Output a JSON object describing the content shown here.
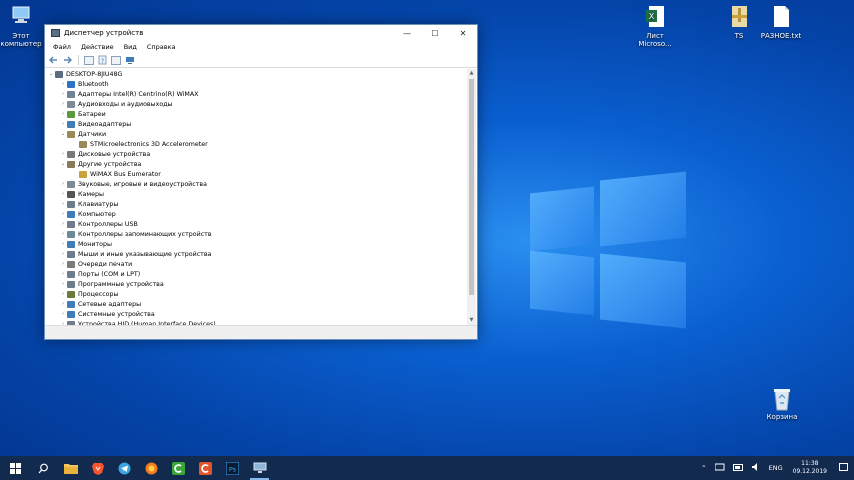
{
  "desktop": {
    "icons": {
      "this_pc": "Этот\nкомпьютер",
      "excel": "Лист\nMicroso...",
      "ts": "TS",
      "txt": "РАЗНОЕ.txt",
      "recycle": "Корзина"
    }
  },
  "window": {
    "title": "Диспетчер устройств",
    "controls": {
      "minimize": "—",
      "maximize": "☐",
      "close": "✕"
    },
    "menu": [
      "Файл",
      "Действие",
      "Вид",
      "Справка"
    ]
  },
  "tree": {
    "root": "DESKTOP-8JIU48G",
    "items": [
      {
        "label": "Bluetooth",
        "expander": "›",
        "child": false,
        "icon_color": "#2f73c9"
      },
      {
        "label": "Адаптеры Intel(R) Centrino(R) WiMAX",
        "expander": "›",
        "child": false,
        "icon_color": "#6f8297"
      },
      {
        "label": "Аудиовходы и аудиовыходы",
        "expander": "›",
        "child": false,
        "icon_color": "#7e8a96"
      },
      {
        "label": "Батареи",
        "expander": "›",
        "child": false,
        "icon_color": "#5b9a3c"
      },
      {
        "label": "Видеоадаптеры",
        "expander": "›",
        "child": false,
        "icon_color": "#3f7db8"
      },
      {
        "label": "Датчики",
        "expander": "⌄",
        "child": false,
        "icon_color": "#9a8a5a"
      },
      {
        "label": "STMicroelectronics 3D Accelerometer",
        "expander": "",
        "child": true,
        "icon_color": "#9a8a5a"
      },
      {
        "label": "Дисковые устройства",
        "expander": "›",
        "child": false,
        "icon_color": "#7a7a7a"
      },
      {
        "label": "Другие устройства",
        "expander": "⌄",
        "child": false,
        "icon_color": "#8a7a5a"
      },
      {
        "label": "WiMAX Bus Eumerator",
        "expander": "",
        "child": true,
        "icon_color": "#c9a23a"
      },
      {
        "label": "Звуковые, игровые и видеоустройства",
        "expander": "›",
        "child": false,
        "icon_color": "#7e8a96"
      },
      {
        "label": "Камеры",
        "expander": "›",
        "child": false,
        "icon_color": "#555555"
      },
      {
        "label": "Клавиатуры",
        "expander": "›",
        "child": false,
        "icon_color": "#6d7d8d"
      },
      {
        "label": "Компьютер",
        "expander": "›",
        "child": false,
        "icon_color": "#3f7db8"
      },
      {
        "label": "Контроллеры USB",
        "expander": "›",
        "child": false,
        "icon_color": "#6d7d8d"
      },
      {
        "label": "Контроллеры запоминающих устройств",
        "expander": "›",
        "child": false,
        "icon_color": "#6d8a9a"
      },
      {
        "label": "Мониторы",
        "expander": "›",
        "child": false,
        "icon_color": "#3f7db8"
      },
      {
        "label": "Мыши и иные указывающие устройства",
        "expander": "›",
        "child": false,
        "icon_color": "#6d7d8d"
      },
      {
        "label": "Очереди печати",
        "expander": "›",
        "child": false,
        "icon_color": "#7a7a7a"
      },
      {
        "label": "Порты (COM и LPT)",
        "expander": "›",
        "child": false,
        "icon_color": "#6d7d8d"
      },
      {
        "label": "Программные устройства",
        "expander": "›",
        "child": false,
        "icon_color": "#6d7d8d"
      },
      {
        "label": "Процессоры",
        "expander": "›",
        "child": false,
        "icon_color": "#6a7a3a"
      },
      {
        "label": "Сетевые адаптеры",
        "expander": "›",
        "child": false,
        "icon_color": "#3f7db8"
      },
      {
        "label": "Системные устройства",
        "expander": "›",
        "child": false,
        "icon_color": "#3f7db8"
      },
      {
        "label": "Устройства HID (Human Interface Devices)",
        "expander": "›",
        "child": false,
        "icon_color": "#6d7d8d"
      }
    ]
  },
  "taskbar": {
    "language": "ENG",
    "time": "11:38",
    "date": "09.12.2019"
  },
  "colors": {
    "taskbar_bg": "#112a4e",
    "desktop_blue": "#0a5fd0",
    "accent": "#8ab8ea"
  }
}
